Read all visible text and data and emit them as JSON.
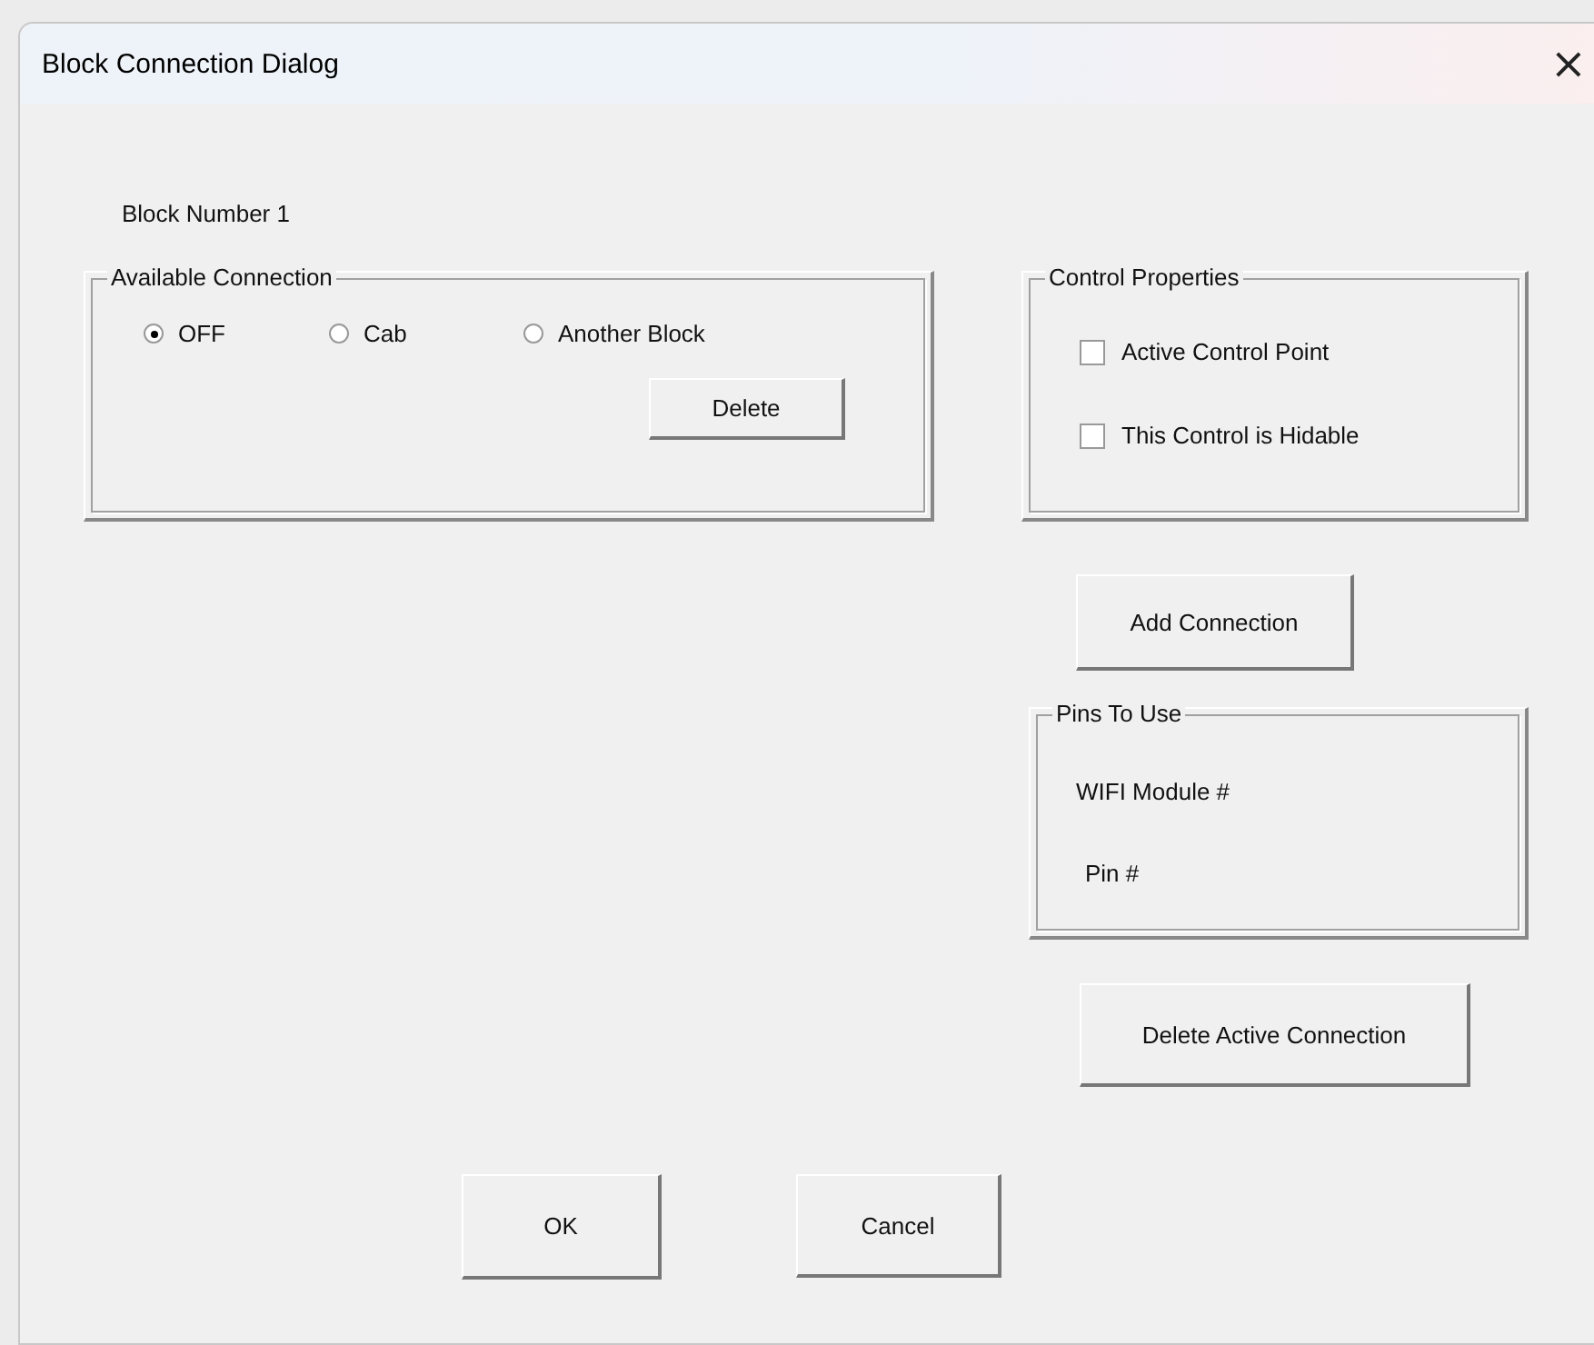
{
  "window": {
    "title": "Block Connection Dialog",
    "close": "×"
  },
  "block_label": "Block Number 1",
  "available_connection": {
    "title": "Available Connection",
    "options": [
      {
        "label": "OFF",
        "selected": true
      },
      {
        "label": "Cab",
        "selected": false
      },
      {
        "label": "Another Block",
        "selected": false
      }
    ],
    "delete_button": "Delete"
  },
  "control_properties": {
    "title": "Control Properties",
    "checkboxes": [
      {
        "label": "Active Control Point",
        "checked": false
      },
      {
        "label": "This Control is Hidable",
        "checked": false
      }
    ]
  },
  "add_connection_button": "Add Connection",
  "pins_to_use": {
    "title": "Pins To Use",
    "labels": [
      "WIFI Module #",
      "Pin #"
    ]
  },
  "delete_active_connection_button": "Delete Active Connection",
  "buttons": [
    "OK",
    "Cancel"
  ]
}
